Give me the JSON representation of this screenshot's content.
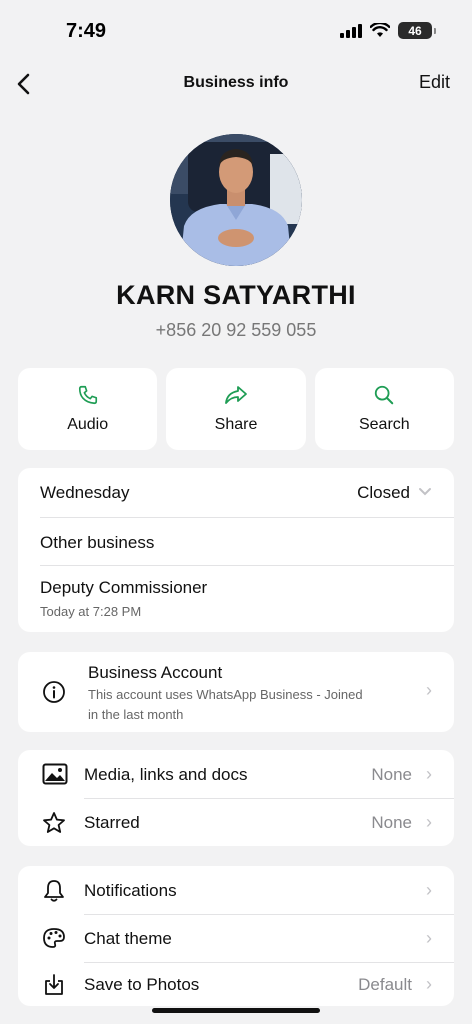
{
  "status_bar": {
    "time": "7:49",
    "battery": "46"
  },
  "nav": {
    "title": "Business info",
    "edit_label": "Edit"
  },
  "profile": {
    "name": "KARN SATYARTHI",
    "phone": "+856 20 92 559 055"
  },
  "actions": [
    {
      "label": "Audio",
      "icon": "phone-icon"
    },
    {
      "label": "Share",
      "icon": "share-icon"
    },
    {
      "label": "Search",
      "icon": "search-icon"
    }
  ],
  "hours": {
    "day": "Wednesday",
    "status": "Closed"
  },
  "business": {
    "category": "Other business",
    "about": "Deputy Commissioner",
    "about_time": "Today at 7:28 PM"
  },
  "account": {
    "title": "Business Account",
    "description_line1": "This account uses WhatsApp Business - Joined",
    "description_line2": "in the last month"
  },
  "media": {
    "label": "Media, links and docs",
    "value": "None"
  },
  "starred": {
    "label": "Starred",
    "value": "None"
  },
  "settings": {
    "notifications": "Notifications",
    "chat_theme": "Chat theme",
    "save_to_photos": "Save to Photos",
    "save_to_photos_value": "Default"
  },
  "colors": {
    "accent": "#1f9d55",
    "background": "#f2f2f3",
    "card": "#ffffff"
  }
}
